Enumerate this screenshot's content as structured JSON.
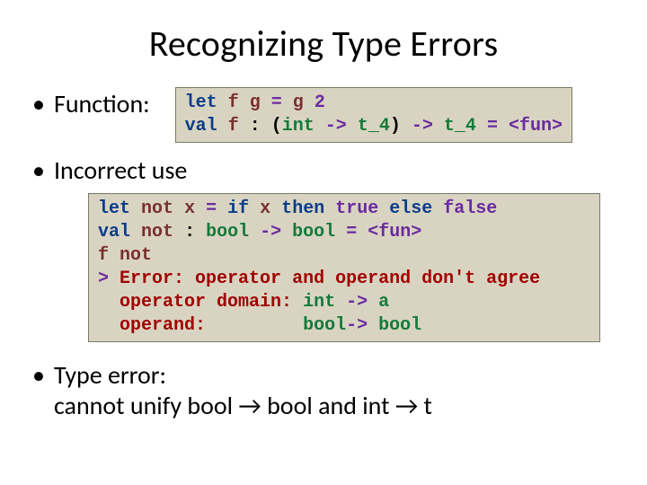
{
  "title": "Recognizing Type Errors",
  "bullets": {
    "b1": "Function:",
    "b2": "Incorrect use",
    "b3_line1": "Type error:",
    "b3_line2_pre": "cannot unify bool ",
    "b3_line2_mid": " bool and  int ",
    "b3_line2_post": " t"
  },
  "code1": {
    "l1": {
      "kw_let": "let",
      "f": "f",
      "g1": "g",
      "eq": "=",
      "g2": "g",
      "two": "2"
    },
    "l2": {
      "kw_val": "val",
      "f": "f",
      "colon": ":",
      "lp": "(",
      "int": "int",
      "arr1": "->",
      "t4a": "t_4",
      "rp": ")",
      "arr2": "->",
      "t4b": "t_4",
      "eq": "=",
      "fun": "<fun>"
    }
  },
  "code2": {
    "l1": {
      "kw_let": "let",
      "not": "not",
      "x1": "x",
      "eq": "=",
      "kw_if": "if",
      "x2": "x",
      "kw_then": "then",
      "tr": "true",
      "kw_else": "else",
      "fl": "false"
    },
    "l2": {
      "kw_val": "val",
      "not": "not",
      "colon": ":",
      "bool1": "bool",
      "arr": "->",
      "bool2": "bool",
      "eq": "=",
      "fun": "<fun>"
    },
    "l3": {
      "f": "f",
      "not": "not"
    },
    "l4": {
      "gt": ">",
      "err": "Error: operator and operand don't agree"
    },
    "l5": {
      "txt": "operator domain: ",
      "int": "int",
      "arr": "->",
      "a": "a"
    },
    "l6": {
      "txt": "operand:         ",
      "bool1": "bool",
      "arr": "->",
      "bool2": "bool"
    }
  },
  "glyphs": {
    "bullet": "•",
    "arrow": "→"
  }
}
